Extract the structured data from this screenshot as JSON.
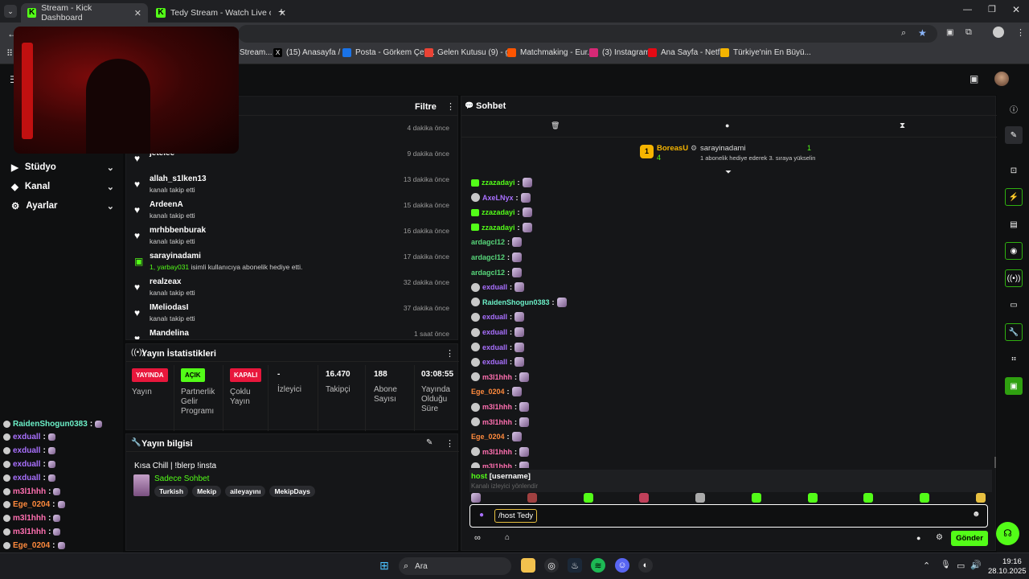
{
  "browser": {
    "tabs": [
      {
        "title": "Stream - Kick Dashboard",
        "active": true
      },
      {
        "title": "Tedy Stream - Watch Live on Ki",
        "active": false
      }
    ],
    "bookmarks": [
      "Stream...",
      "(15) Anasayfa / X",
      "Posta - Görkem Çeti...",
      "Gelen Kutusu (9) - g...",
      "Matchmaking - Eur...",
      "(3) Instagram",
      "Ana Sayfa - Netflix",
      "Türkiye'nin En Büyü..."
    ]
  },
  "sidebar": {
    "items": [
      {
        "label": "Stüdyo",
        "icon": "studio-icon"
      },
      {
        "label": "Kanal",
        "icon": "channel-icon"
      },
      {
        "label": "Ayarlar",
        "icon": "gear-icon"
      }
    ]
  },
  "activity": {
    "filter_label": "Filtre",
    "items": [
      {
        "name": "",
        "desc": "",
        "time": "4 dakika önce",
        "icon": "heart"
      },
      {
        "name": "jetelee",
        "desc": "",
        "time": "9 dakika önce",
        "icon": "heart"
      },
      {
        "name": "allah_s1lken13",
        "desc": "kanalı takip etti",
        "time": "13 dakika önce",
        "icon": "heart"
      },
      {
        "name": "ArdeenA",
        "desc": "kanalı takip etti",
        "time": "15 dakika önce",
        "icon": "heart"
      },
      {
        "name": "mrhbbenburak",
        "desc": "kanalı takip etti",
        "time": "16 dakika önce",
        "icon": "heart"
      },
      {
        "name": "sarayinadami",
        "desc_hl": "1, yarbay031",
        "desc": " isimli kullanıcıya abonelik hediye etti.",
        "time": "17 dakika önce",
        "icon": "gift"
      },
      {
        "name": "realzeax",
        "desc": "kanalı takip etti",
        "time": "32 dakika önce",
        "icon": "heart"
      },
      {
        "name": "IMeliodasI",
        "desc": "kanalı takip etti",
        "time": "37 dakika önce",
        "icon": "heart"
      },
      {
        "name": "Mandelina",
        "desc": "",
        "time": "1 saat önce",
        "icon": "heart"
      }
    ]
  },
  "stats": {
    "title": "Yayın İstatistikleri",
    "cols": [
      {
        "badge": "YAYINDA",
        "badge_color": "#e8173c",
        "label": "Yayın"
      },
      {
        "badge": "AÇIK",
        "badge_color": "#53fc18",
        "label": "Partnerlik Gelir Programı"
      },
      {
        "badge": "KAPALI",
        "badge_color": "#e8173c",
        "label": "Çoklu Yayın"
      },
      {
        "value": "-",
        "label": "İzleyici"
      },
      {
        "value": "16.470",
        "label": "Takipçi"
      },
      {
        "value": "188",
        "label": "Abone Sayısı"
      },
      {
        "value": "03:08:55",
        "label": "Yayında Olduğu Süre"
      }
    ]
  },
  "stream_info": {
    "title": "Yayın bilgisi",
    "stream_title": "Kısa Chill | !blerp !insta",
    "category": "Sadece Sohbet",
    "tags": [
      "Turkish",
      "Mekip",
      "aileyayını",
      "MekipDays"
    ]
  },
  "chat": {
    "title": "Sohbet",
    "pinned": {
      "user": "BoreasU",
      "rank": "1",
      "count": "4",
      "user2": "sarayinadami",
      "count2": "1",
      "desc": "1 abonelik hediye ederek 3. sıraya yükselin"
    },
    "messages": [
      {
        "user": "zzazadayi",
        "color": "#53fc18",
        "badge": "sub"
      },
      {
        "user": "AxeLNyx",
        "color": "#a970ff",
        "badge": "avatar"
      },
      {
        "user": "zzazadayi",
        "color": "#53fc18",
        "badge": "sub"
      },
      {
        "user": "zzazadayi",
        "color": "#53fc18",
        "badge": "sub"
      },
      {
        "user": "ardagcl12",
        "color": "#57d67a",
        "badge": "none"
      },
      {
        "user": "ardagcl12",
        "color": "#57d67a",
        "badge": "none"
      },
      {
        "user": "ardagcl12",
        "color": "#57d67a",
        "badge": "none"
      },
      {
        "user": "exduall",
        "color": "#a970ff",
        "badge": "avatar"
      },
      {
        "user": "RaidenShogun0383",
        "color": "#6cf0c8",
        "badge": "avatar"
      },
      {
        "user": "exduall",
        "color": "#a970ff",
        "badge": "avatar"
      },
      {
        "user": "exduall",
        "color": "#a970ff",
        "badge": "avatar"
      },
      {
        "user": "exduall",
        "color": "#a970ff",
        "badge": "avatar"
      },
      {
        "user": "exduall",
        "color": "#a970ff",
        "badge": "avatar"
      },
      {
        "user": "m3l1hhh",
        "color": "#ff6fb0",
        "badge": "avatar"
      },
      {
        "user": "Ege_0204",
        "color": "#ff8a3d",
        "badge": "none"
      },
      {
        "user": "m3l1hhh",
        "color": "#ff6fb0",
        "badge": "avatar"
      },
      {
        "user": "m3l1hhh",
        "color": "#ff6fb0",
        "badge": "avatar"
      },
      {
        "user": "Ege_0204",
        "color": "#ff8a3d",
        "badge": "none"
      },
      {
        "user": "m3l1hhh",
        "color": "#ff6fb0",
        "badge": "avatar"
      },
      {
        "user": "m3l1hhh",
        "color": "#ff6fb0",
        "badge": "avatar"
      }
    ],
    "suggest": {
      "cmd": "host",
      "arg": "[username]",
      "desc": "Kanalı izleyici yönlendir"
    },
    "input_value": "/host Tedy",
    "send_label": "Gönder"
  },
  "overlay_chat": [
    {
      "user": "RaidenShogun0383",
      "color": "#6cf0c8"
    },
    {
      "user": "exduall",
      "color": "#a970ff"
    },
    {
      "user": "exduall",
      "color": "#a970ff"
    },
    {
      "user": "exduall",
      "color": "#a970ff"
    },
    {
      "user": "exduall",
      "color": "#a970ff"
    },
    {
      "user": "m3l1hhh",
      "color": "#ff6fb0"
    },
    {
      "user": "Ege_0204",
      "color": "#ff8a3d"
    },
    {
      "user": "m3l1hhh",
      "color": "#ff6fb0"
    },
    {
      "user": "m3l1hhh",
      "color": "#ff6fb0"
    },
    {
      "user": "Ege_0204",
      "color": "#ff8a3d"
    },
    {
      "user": "m3l1hhh",
      "color": "#ff6fb0"
    }
  ],
  "taskbar": {
    "search": "Ara",
    "time": "19:16",
    "date": "28.10.2025"
  }
}
